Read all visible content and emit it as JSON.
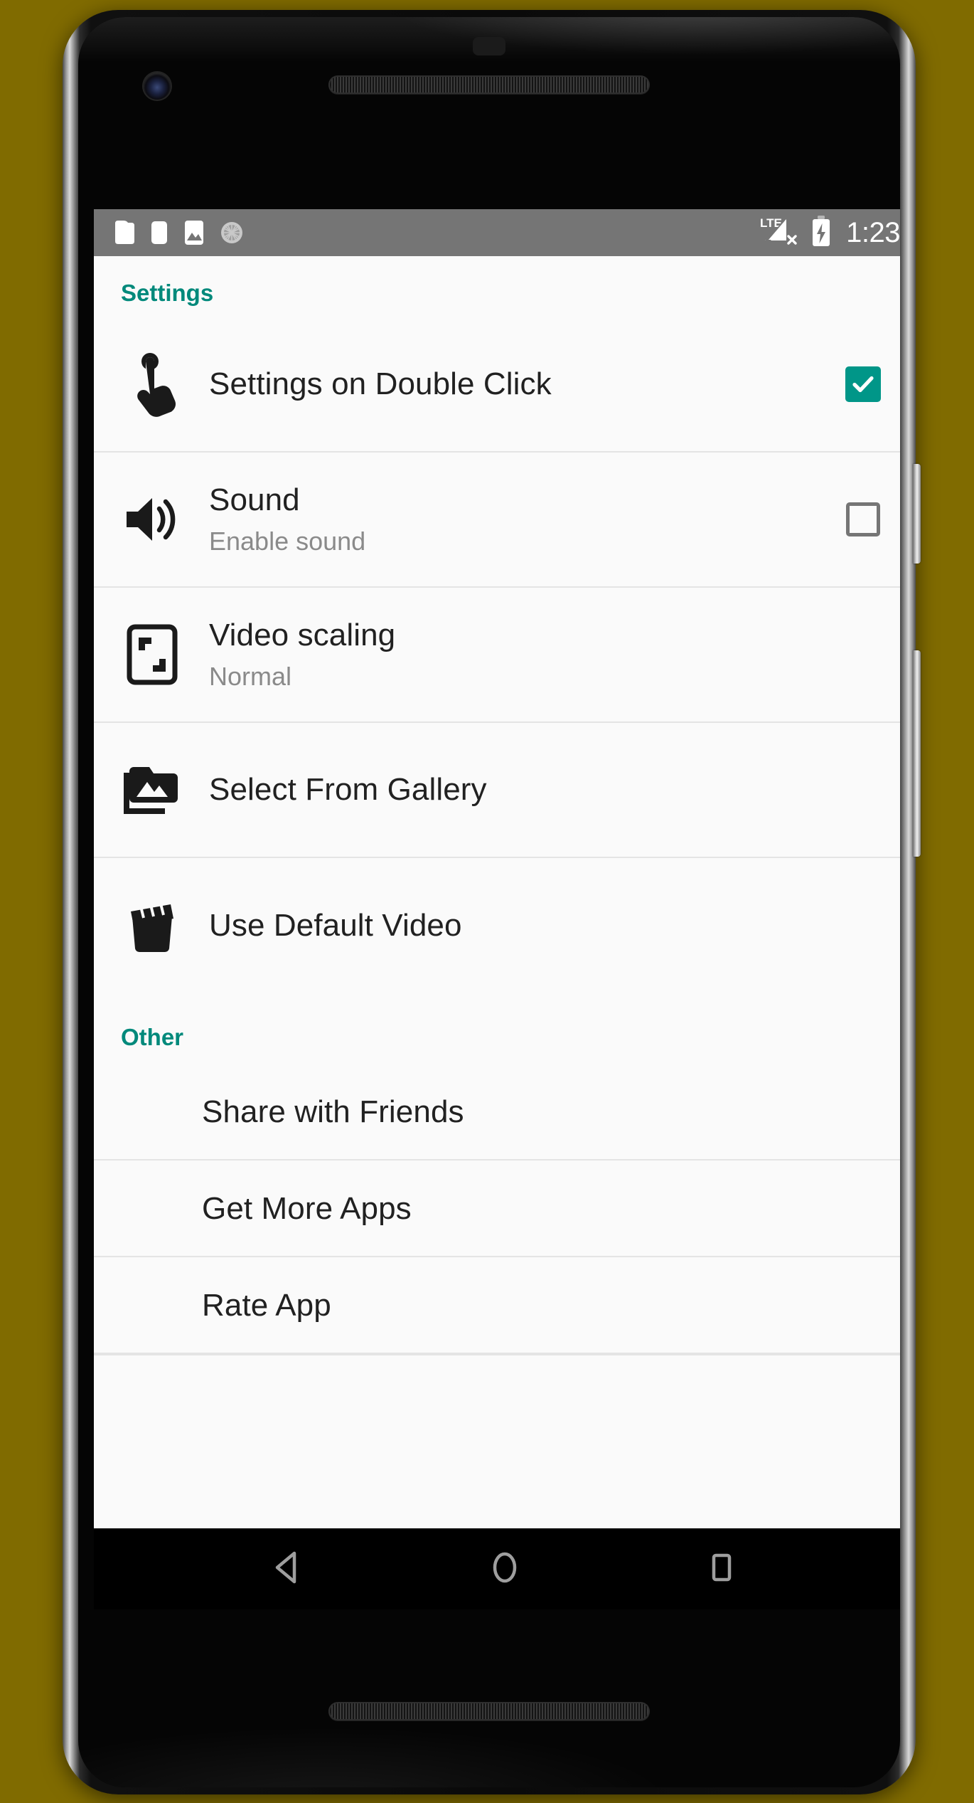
{
  "device": {
    "frame_color": "#0a0a0a",
    "backdrop_color": "#806B00"
  },
  "status_bar": {
    "background": "#757575",
    "clock": "1:23",
    "network_label": "LTE",
    "notification_icons": [
      "notification-card-icon",
      "notification-card-small-icon",
      "image-icon",
      "sync-spinner-icon"
    ],
    "signal": "no-signal-icon",
    "battery": "battery-charging-icon"
  },
  "sections": [
    {
      "title": "Settings",
      "title_color": "#00897B",
      "rows": [
        {
          "icon": "touch-tap-icon",
          "title": "Settings on Double Click",
          "summary": "",
          "widget": "checkbox",
          "checked": true
        },
        {
          "icon": "volume-up-icon",
          "title": "Sound",
          "summary": "Enable sound",
          "widget": "checkbox",
          "checked": false
        },
        {
          "icon": "video-scaling-icon",
          "title": "Video scaling",
          "summary": "Normal",
          "widget": "none",
          "checked": false
        },
        {
          "icon": "photo-library-icon",
          "title": "Select From Gallery",
          "summary": "",
          "widget": "none",
          "checked": false
        },
        {
          "icon": "movie-clapper-icon",
          "title": "Use Default Video",
          "summary": "",
          "widget": "none",
          "checked": false
        }
      ]
    },
    {
      "title": "Other",
      "title_color": "#00897B",
      "rows": [
        {
          "icon": "none",
          "title": "Share with Friends",
          "summary": "",
          "widget": "none",
          "checked": false
        },
        {
          "icon": "none",
          "title": "Get More Apps",
          "summary": "",
          "widget": "none",
          "checked": false
        },
        {
          "icon": "none",
          "title": "Rate App",
          "summary": "",
          "widget": "none",
          "checked": false
        }
      ]
    }
  ],
  "nav_bar": {
    "background": "#000000",
    "buttons": [
      {
        "name": "back-button",
        "icon": "back-triangle-icon"
      },
      {
        "name": "home-button",
        "icon": "home-circle-icon"
      },
      {
        "name": "recents-button",
        "icon": "recents-square-icon"
      }
    ]
  },
  "theme": {
    "accent": "#009688",
    "section_header": "#00897B",
    "list_background": "#FAFAFA",
    "divider": "#E4E4E4",
    "primary_text": "#212121",
    "secondary_text": "#8A8A8A",
    "checkbox_border": "#757575"
  }
}
